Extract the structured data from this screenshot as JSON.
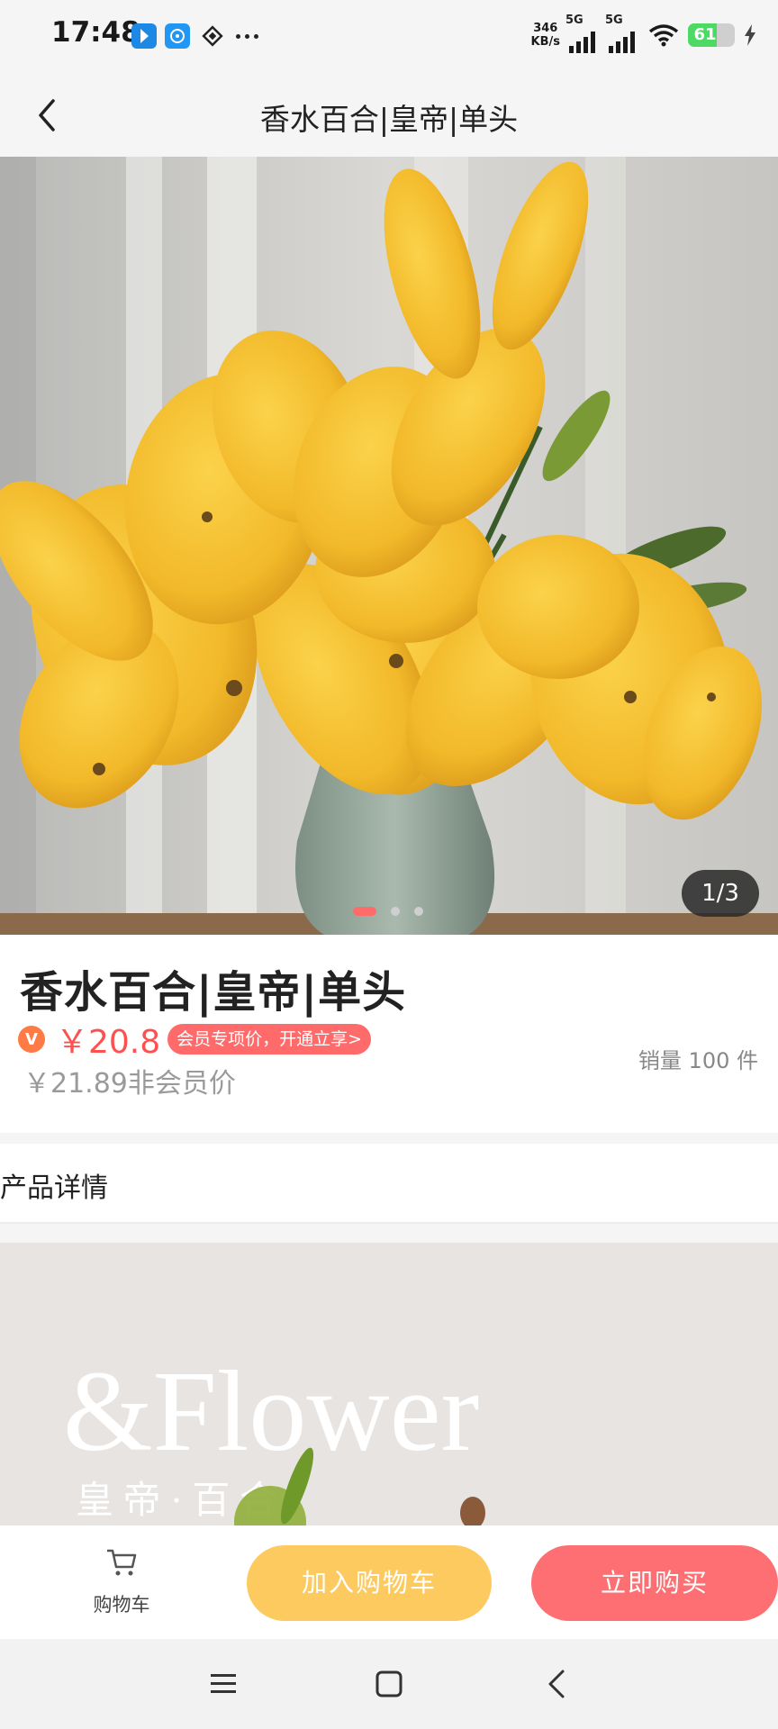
{
  "status_bar": {
    "time": "17:48",
    "net_speed_value": "346",
    "net_speed_unit": "KB/s",
    "sim1_label": "5G",
    "sim2_label": "5G",
    "battery": "61",
    "battery_level_percent": 61,
    "icons": [
      "app-notification-icon-1",
      "app-notification-icon-2",
      "app-notification-icon-3",
      "more-dots-icon",
      "wifi-icon",
      "charging-icon"
    ]
  },
  "navbar": {
    "title": "香水百合|皇帝|单头"
  },
  "hero": {
    "counter": "1/3",
    "dots": 3,
    "active_dot": 0
  },
  "product": {
    "title": "香水百合|皇帝|单头",
    "vip_badge": "V",
    "vip_price": "￥20.8",
    "member_tag": "会员专项价，开通立享>",
    "normal_price": "￥21.89非会员价",
    "sales": "销量 100 件"
  },
  "details": {
    "title": "产品详情",
    "image_brand": "&Flower",
    "image_caption": "皇 帝 · 百 合"
  },
  "actions": {
    "cart_label": "购物车",
    "add_to_cart": "加入购物车",
    "buy_now": "立即购买"
  },
  "colors": {
    "accent_red": "#ff5050",
    "add_cart_yellow": "#fdca60",
    "buy_now_red": "#fd6f73"
  }
}
